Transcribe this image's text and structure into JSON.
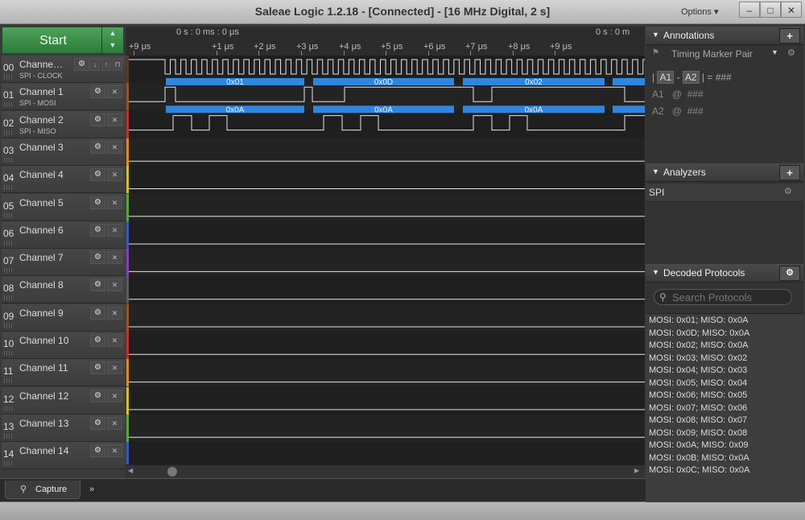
{
  "window": {
    "title": "Saleae Logic 1.2.18 - [Connected] - [16 MHz Digital, 2 s]",
    "options_label": "Options ▾",
    "minimize": "–",
    "maximize": "□",
    "close": "✕"
  },
  "start": {
    "label": "Start",
    "up": "▲",
    "down": "▼"
  },
  "timeline": {
    "left_time": "0 s : 0 ms : 0 μs",
    "right_time": "0 s : 0 m",
    "ticks": [
      "+9 μs",
      "+1 μs",
      "+2 μs",
      "+3 μs",
      "+4 μs",
      "+5 μs",
      "+6 μs",
      "+7 μs",
      "+8 μs",
      "+9 μs"
    ]
  },
  "channels": [
    {
      "num": "00",
      "name": "Channe…",
      "sub": "SPI - CLOCK",
      "color": "#5a3a28",
      "extra_buttons": true
    },
    {
      "num": "01",
      "name": "Channel 1",
      "sub": "SPI - MOSI",
      "color": "#a0521e"
    },
    {
      "num": "02",
      "name": "Channel 2",
      "sub": "SPI - MISO",
      "color": "#c62e2e"
    },
    {
      "num": "03",
      "name": "Channel 3",
      "sub": "",
      "color": "#e08a1e"
    },
    {
      "num": "04",
      "name": "Channel 4",
      "sub": "",
      "color": "#d7c21e"
    },
    {
      "num": "05",
      "name": "Channel 5",
      "sub": "",
      "color": "#53a83b"
    },
    {
      "num": "06",
      "name": "Channel 6",
      "sub": "",
      "color": "#3b56c6"
    },
    {
      "num": "07",
      "name": "Channel 7",
      "sub": "",
      "color": "#8c3bc6"
    },
    {
      "num": "08",
      "name": "Channel 8",
      "sub": "",
      "color": "#5c5c5c"
    },
    {
      "num": "09",
      "name": "Channel 9",
      "sub": "",
      "color": "#a0521e"
    },
    {
      "num": "10",
      "name": "Channel 10",
      "sub": "",
      "color": "#c62e2e"
    },
    {
      "num": "11",
      "name": "Channel 11",
      "sub": "",
      "color": "#e08a1e"
    },
    {
      "num": "12",
      "name": "Channel 12",
      "sub": "",
      "color": "#d7c21e"
    },
    {
      "num": "13",
      "name": "Channel 13",
      "sub": "",
      "color": "#53a83b"
    },
    {
      "num": "14",
      "name": "Channel 14",
      "sub": "",
      "color": "#3b56c6"
    }
  ],
  "channel_buttons": {
    "settings": "⚙",
    "remove": "✕"
  },
  "mosi_bytes": [
    "0x01",
    "0x0D",
    "0x02"
  ],
  "miso_bytes": [
    "0x0A",
    "0x0A",
    "0x0A"
  ],
  "bottom": {
    "capture_tab": "Capture",
    "capture_icon": "magnifier-icon",
    "more": "»"
  },
  "annotations": {
    "header": "Annotations",
    "add": "+",
    "marker_pair": "Timing Marker Pair",
    "a1_label": "A1",
    "a2_label": "A2",
    "diff_value": "###",
    "a1_value": "###",
    "a2_value": "###",
    "at": "@",
    "equals": "=",
    "pipe": "|"
  },
  "analyzers": {
    "header": "Analyzers",
    "add": "+",
    "items": [
      "SPI"
    ]
  },
  "decoded": {
    "header": "Decoded Protocols",
    "search_placeholder": "Search Protocols",
    "items": [
      "MOSI: 0x01;  MISO: 0x0A",
      "MOSI: 0x0D;  MISO: 0x0A",
      "MOSI: 0x02;  MISO: 0x0A",
      "MOSI: 0x03;  MISO: 0x02",
      "MOSI: 0x04;  MISO: 0x03",
      "MOSI: 0x05;  MISO: 0x04",
      "MOSI: 0x06;  MISO: 0x05",
      "MOSI: 0x07;  MISO: 0x06",
      "MOSI: 0x08;  MISO: 0x07",
      "MOSI: 0x09;  MISO: 0x08",
      "MOSI: 0x0A;  MISO: 0x09",
      "MOSI: 0x0B;  MISO: 0x0A",
      "MOSI: 0x0C;  MISO: 0x0A"
    ]
  },
  "colors": {
    "decode_bar": "#2f86e0",
    "start_green": "#3a8f46",
    "wave_line": "#e6e6e6"
  }
}
